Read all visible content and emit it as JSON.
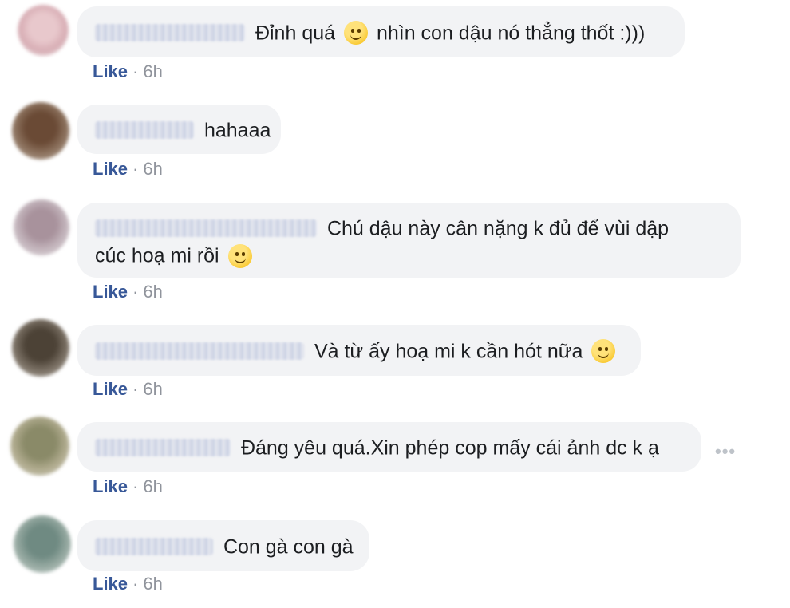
{
  "like_label": "Like",
  "separator": "·",
  "more_icon": "•••",
  "comments": [
    {
      "text": "Đỉnh quá",
      "text_after": "nhìn con dậu nó thẳng thốt :)))",
      "time": "6h"
    },
    {
      "text": "hahaaa",
      "time": "6h"
    },
    {
      "text_line1": "Chú dậu này cân nặng k đủ để vùi dập",
      "text_line2": "cúc hoạ mi rồi",
      "time": "6h"
    },
    {
      "text": "Và từ ấy hoạ mi k cần hót nữa",
      "time": "6h"
    },
    {
      "text": "Đáng yêu quá.Xin phép cop mấy cái ảnh dc k ạ",
      "time": "6h"
    },
    {
      "text": "Con gà con gà",
      "time": "6h"
    }
  ]
}
